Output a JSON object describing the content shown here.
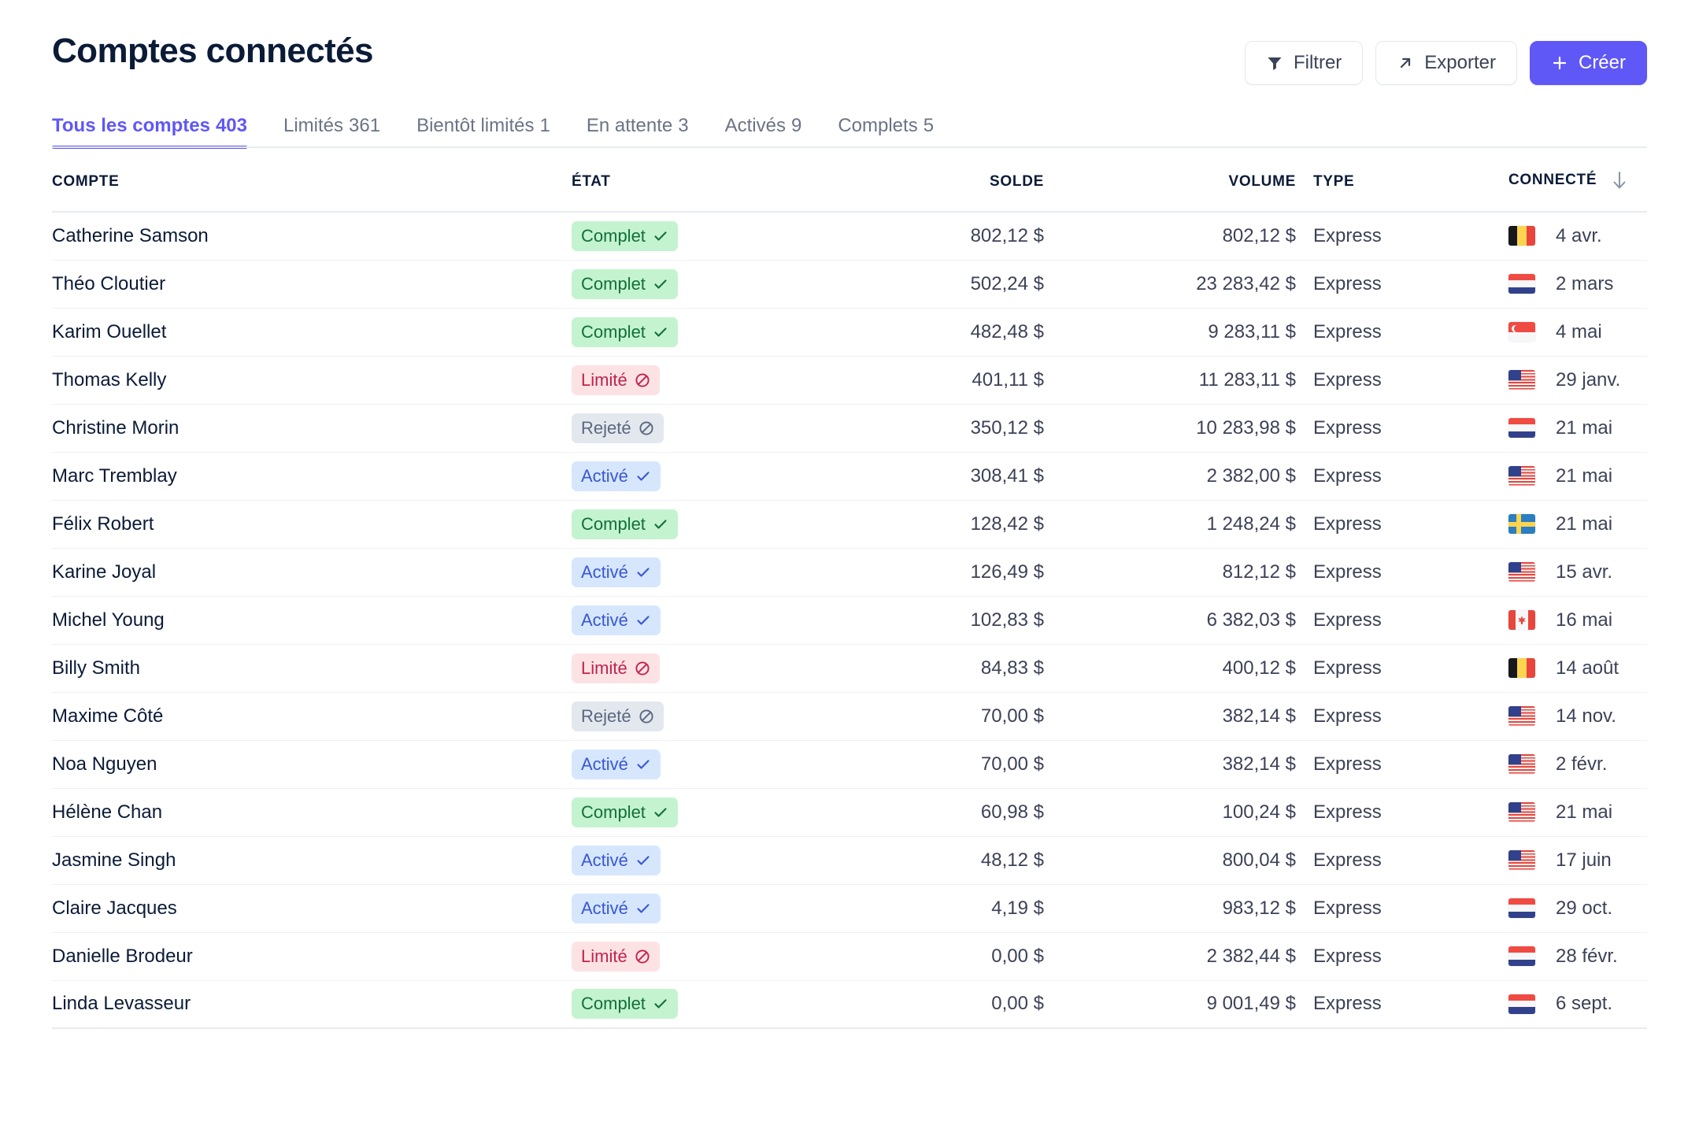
{
  "header": {
    "title": "Comptes connectés",
    "buttons": {
      "filter": "Filtrer",
      "export": "Exporter",
      "create": "Créer"
    }
  },
  "tabs": [
    {
      "label": "Tous les comptes",
      "count": "403",
      "active": true
    },
    {
      "label": "Limités",
      "count": "361",
      "active": false
    },
    {
      "label": "Bientôt limités",
      "count": "1",
      "active": false
    },
    {
      "label": "En attente",
      "count": "3",
      "active": false
    },
    {
      "label": "Activés",
      "count": "9",
      "active": false
    },
    {
      "label": "Complets",
      "count": "5",
      "active": false
    }
  ],
  "table": {
    "columns": {
      "account": "COMPTE",
      "state": "ÉTAT",
      "balance": "SOLDE",
      "volume": "VOLUME",
      "type": "TYPE",
      "connected": "CONNECTÉ"
    },
    "sort": {
      "column": "CONNECTÉ",
      "direction": "desc",
      "icon": "arrow-down-icon"
    },
    "rows": [
      {
        "account": "Catherine Samson",
        "state": "Complet",
        "state_kind": "complet",
        "balance": "802,12 $",
        "volume": "802,12 $",
        "type": "Express",
        "flag": "be",
        "connected": "4 avr."
      },
      {
        "account": "Théo Cloutier",
        "state": "Complet",
        "state_kind": "complet",
        "balance": "502,24 $",
        "volume": "23 283,42 $",
        "type": "Express",
        "flag": "nl",
        "connected": "2 mars"
      },
      {
        "account": "Karim Ouellet",
        "state": "Complet",
        "state_kind": "complet",
        "balance": "482,48 $",
        "volume": "9 283,11 $",
        "type": "Express",
        "flag": "sg",
        "connected": "4 mai"
      },
      {
        "account": "Thomas Kelly",
        "state": "Limité",
        "state_kind": "limite",
        "balance": "401,11 $",
        "volume": "11 283,11 $",
        "type": "Express",
        "flag": "us",
        "connected": "29 janv."
      },
      {
        "account": "Christine Morin",
        "state": "Rejeté",
        "state_kind": "rejete",
        "balance": "350,12 $",
        "volume": "10 283,98 $",
        "type": "Express",
        "flag": "nl",
        "connected": "21 mai"
      },
      {
        "account": "Marc Tremblay",
        "state": "Activé",
        "state_kind": "active",
        "balance": "308,41 $",
        "volume": "2 382,00 $",
        "type": "Express",
        "flag": "us",
        "connected": "21 mai"
      },
      {
        "account": "Félix Robert",
        "state": "Complet",
        "state_kind": "complet",
        "balance": "128,42 $",
        "volume": "1 248,24 $",
        "type": "Express",
        "flag": "se",
        "connected": "21 mai"
      },
      {
        "account": "Karine Joyal",
        "state": "Activé",
        "state_kind": "active",
        "balance": "126,49 $",
        "volume": "812,12 $",
        "type": "Express",
        "flag": "us",
        "connected": "15 avr."
      },
      {
        "account": "Michel Young",
        "state": "Activé",
        "state_kind": "active",
        "balance": "102,83 $",
        "volume": "6 382,03 $",
        "type": "Express",
        "flag": "ca",
        "connected": "16 mai"
      },
      {
        "account": "Billy Smith",
        "state": "Limité",
        "state_kind": "limite",
        "balance": "84,83 $",
        "volume": "400,12 $",
        "type": "Express",
        "flag": "be",
        "connected": "14 août"
      },
      {
        "account": "Maxime Côté",
        "state": "Rejeté",
        "state_kind": "rejete",
        "balance": "70,00 $",
        "volume": "382,14 $",
        "type": "Express",
        "flag": "us",
        "connected": "14 nov."
      },
      {
        "account": "Noa Nguyen",
        "state": "Activé",
        "state_kind": "active",
        "balance": "70,00 $",
        "volume": "382,14 $",
        "type": "Express",
        "flag": "us",
        "connected": "2 févr."
      },
      {
        "account": "Hélène Chan",
        "state": "Complet",
        "state_kind": "complet",
        "balance": "60,98 $",
        "volume": "100,24 $",
        "type": "Express",
        "flag": "us",
        "connected": "21 mai"
      },
      {
        "account": "Jasmine Singh",
        "state": "Activé",
        "state_kind": "active",
        "balance": "48,12 $",
        "volume": "800,04 $",
        "type": "Express",
        "flag": "us",
        "connected": "17 juin"
      },
      {
        "account": "Claire Jacques",
        "state": "Activé",
        "state_kind": "active",
        "balance": "4,19 $",
        "volume": "983,12 $",
        "type": "Express",
        "flag": "nl",
        "connected": "29 oct."
      },
      {
        "account": "Danielle Brodeur",
        "state": "Limité",
        "state_kind": "limite",
        "balance": "0,00 $",
        "volume": "2 382,44 $",
        "type": "Express",
        "flag": "nl",
        "connected": "28 févr."
      },
      {
        "account": "Linda Levasseur",
        "state": "Complet",
        "state_kind": "complet",
        "balance": "0,00 $",
        "volume": "9 001,49 $",
        "type": "Express",
        "flag": "nl",
        "connected": "6 sept."
      }
    ]
  },
  "colors": {
    "brand_purple": "#5f57f6",
    "title_navy": "#0b1b37",
    "text_slate": "#3c4257",
    "muted": "#6b7385",
    "badge_green_bg": "#c4f3cf",
    "badge_green_fg": "#11703a",
    "badge_red_bg": "#fde2e4",
    "badge_red_fg": "#c1224f",
    "badge_gray_bg": "#e3e8ee",
    "badge_gray_fg": "#5c6780",
    "badge_blue_bg": "#d6e7fd",
    "badge_blue_fg": "#3956d4"
  }
}
